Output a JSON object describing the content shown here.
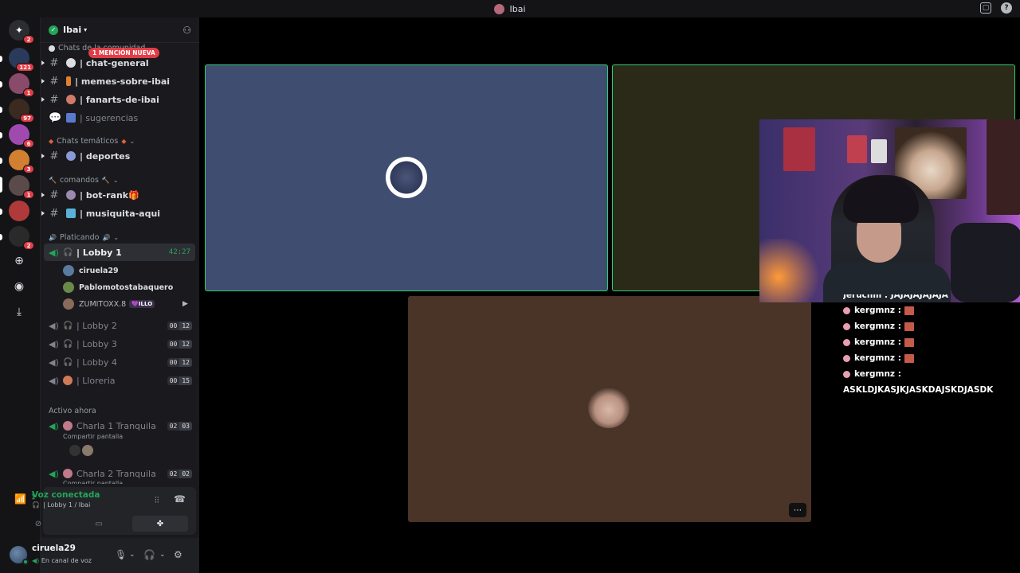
{
  "titlebar": {
    "title": "Ibai"
  },
  "rail": {
    "badges": [
      "2",
      "121",
      "1",
      "97",
      "6",
      "3",
      "1",
      "2"
    ]
  },
  "server": {
    "name": "Ibai",
    "mention_badge": "1 MENCIÓN NUEVA",
    "categories": {
      "chats_general": "Chats de la comunidad",
      "chats_tematicos": "Chats temáticos",
      "comandos": "comandos",
      "platicando": "Platicando",
      "activo_ahora": "Activo ahora"
    },
    "channels": [
      {
        "name": "| chat-general"
      },
      {
        "name": "| memes-sobre-ibai"
      },
      {
        "name": "| fanarts-de-ibai"
      },
      {
        "name": "| sugerencias"
      },
      {
        "name": "| deportes"
      },
      {
        "name": "| bot-rank🎁"
      },
      {
        "name": "| musiquita-aqui"
      }
    ],
    "voice": {
      "lobby1": {
        "name": "| Lobby 1",
        "timer": "42:27"
      },
      "members": [
        {
          "name": "ciruela29"
        },
        {
          "name": "Pablomotostabaquero"
        },
        {
          "name": "ZUMITOXX.8",
          "tag": "💜ILLO"
        }
      ],
      "lobby2": {
        "name": "| Lobby 2",
        "c1": "00",
        "c2": "12"
      },
      "lobby3": {
        "name": "| Lobby 3",
        "c1": "00",
        "c2": "12"
      },
      "lobby4": {
        "name": "| Lobby 4",
        "c1": "00",
        "c2": "12"
      },
      "lloreria": {
        "name": "| Lloreria",
        "c1": "00",
        "c2": "15"
      }
    },
    "active": [
      {
        "name": "Charla 1 Tranquila",
        "sub": "Compartir pantalla",
        "c1": "02",
        "c2": "03"
      },
      {
        "name": "Charla 2 Tranquila",
        "sub": "Compartir pantalla",
        "c1": "02",
        "c2": "02"
      }
    ]
  },
  "voice_panel": {
    "status": "Voz conectada",
    "location": "| Lobby 1 / Ibai"
  },
  "user_panel": {
    "username": "ciruela29",
    "status": "En canal de voz"
  },
  "chat_overlay": {
    "cut_line": "Jeruchill : JAJAJAJAJAJA",
    "lines": [
      {
        "user": "kergmnz :"
      },
      {
        "user": "kergmnz :"
      },
      {
        "user": "kergmnz :"
      },
      {
        "user": "kergmnz :"
      },
      {
        "user": "kergmnz :"
      }
    ],
    "last_message": "ASKLDJKASJKJASKDAJSKDJASDK"
  },
  "colors": {
    "speaking": "#2dcc70",
    "tile_blue": "#3f4d70",
    "tile_olive": "#2b2a18",
    "tile_brown": "#4a3327",
    "discord_green": "#23a55a",
    "mention_red": "#e23d46"
  },
  "icons": [
    "discord-home-icon",
    "add-server-icon",
    "discover-icon",
    "download-icon",
    "add-friend-icon",
    "hash-icon",
    "speaker-icon",
    "headphones-icon",
    "signal-icon",
    "waveform-icon",
    "disconnect-icon",
    "camera-off-icon",
    "screen-share-icon",
    "activities-icon",
    "mic-icon",
    "headset-icon",
    "settings-icon",
    "more-icon"
  ]
}
